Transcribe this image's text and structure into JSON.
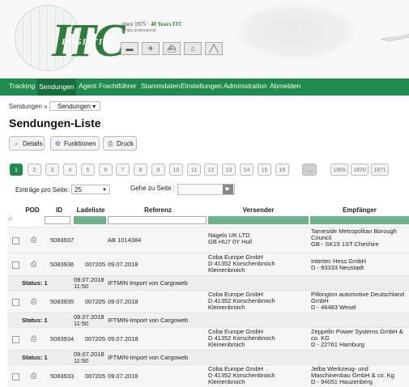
{
  "banner": {
    "logo_text": "ITC",
    "logo_sub": "LOGISTIC",
    "since_prefix": "since 1975 · ",
    "since_highlight": "40 Years ITC",
    "tagline": "simply professional",
    "icons": [
      "truck-icon",
      "plane-icon",
      "ship-icon",
      "warehouse-icon",
      "road-icon"
    ]
  },
  "nav": {
    "items": [
      {
        "label": "Tracking",
        "name": "nav-tracking"
      },
      {
        "label": "Sendungen",
        "name": "nav-sendungen",
        "active": true
      },
      {
        "label": "Agent",
        "name": "nav-agent"
      },
      {
        "label": "Frachtführer",
        "name": "nav-frachtfuehrer"
      },
      {
        "label": "Stammdaten",
        "name": "nav-stammdaten"
      },
      {
        "label": "Einstellungen",
        "name": "nav-einstellungen"
      },
      {
        "label": "Administration",
        "name": "nav-administration"
      },
      {
        "label": "Abmelden",
        "name": "nav-abmelden"
      }
    ]
  },
  "breadcrumb": {
    "root": "Sendungen »",
    "current": "Sendungen ▾"
  },
  "page_title": "Sendungen-Liste",
  "toolbar": {
    "details": "Details",
    "funktionen": "Funktionen",
    "druck": "Druck"
  },
  "pagination": {
    "pages": [
      "1",
      "2",
      "3",
      "4",
      "5",
      "6",
      "7",
      "8",
      "9",
      "10",
      "11",
      "12",
      "13",
      "14",
      "15",
      "16"
    ],
    "ellipsis": "...",
    "last_pages": [
      "1869",
      "1870",
      "1871"
    ]
  },
  "entries": {
    "label": "Einträge pro Seite:",
    "value": "25",
    "goto_label": "Gehe zu Seite :"
  },
  "table": {
    "headers": {
      "pod": "POD",
      "id": "ID",
      "ladeliste": "Ladeliste",
      "referenz": "Referenz",
      "versender": "Versender",
      "empfaenger": "Empfänger"
    },
    "status_label": "Status:",
    "rows": [
      {
        "id": "5083937",
        "ladeliste": "",
        "date": "",
        "referenz": "AB 1014384",
        "versender": [
          "Nagels UK LTD",
          "GB   HU7 0Y Hull"
        ],
        "empfaenger": [
          "Tameside Metropolitan Borough",
          "Council",
          "GB - SK15 1ST Cheshire"
        ]
      },
      {
        "id": "5083936",
        "ladeliste": "007205",
        "date": "09.07.2018",
        "referenz": "",
        "versender": [
          "Coba Europe GmbH",
          "D   41352 Korschenbroich",
          "Kleinenbroich"
        ],
        "empfaenger": [
          "Intertec Hess GmbH",
          "D - 93333 Neustadt"
        ],
        "status": {
          "value": "1",
          "time": [
            "09.07.2018",
            "11:50"
          ],
          "text": "IFTMIN Import von Cargoweb"
        }
      },
      {
        "id": "5083935",
        "ladeliste": "007205",
        "date": "09.07.2018",
        "referenz": "",
        "versender": [
          "Coba Europe GmbH",
          "D   41352 Korschenbroich",
          "Kleinenbroich"
        ],
        "empfaenger": [
          "Pilkington automotive Deutschland",
          "GmbH",
          "D - 46483 Wesel"
        ],
        "status": {
          "value": "1",
          "time": [
            "09.07.2018",
            "11:50"
          ],
          "text": "IFTMIN-Import von Cargoweb"
        }
      },
      {
        "id": "5083934",
        "ladeliste": "007205",
        "date": "09.07.2018",
        "referenz": "",
        "versender": [
          "Coba Europe GmbH",
          "D   41352 Korschenbroich",
          "Kleinenbroich"
        ],
        "empfaenger": [
          "Zeppelin Power Systems GmbH &",
          "co. KG",
          "D - 22761 Hamburg"
        ],
        "status": {
          "value": "1",
          "time": [
            "09.07.2018",
            "11:50"
          ],
          "text": "IFTMIN-Import von Cargoweb"
        }
      },
      {
        "id": "5083933",
        "ladeliste": "007205",
        "date": "09.07.2018",
        "referenz": "",
        "versender": [
          "Coba Europe GmbH",
          "D   41352 Korschenbroich",
          "Kleinenbroich"
        ],
        "empfaenger": [
          "Jelba Werkzeug- und",
          "Maschinenbau GmbH & co. Kg",
          "D - 94051 Hauzenberg"
        ]
      }
    ]
  }
}
